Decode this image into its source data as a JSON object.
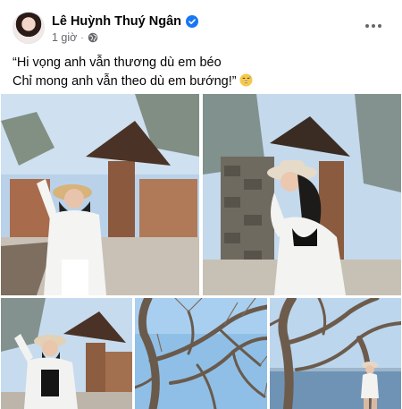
{
  "post": {
    "author": {
      "name": "Lê Huỳnh Thuý Ngân",
      "verified_icon": "verified-badge-icon",
      "avatar_icon": "profile-avatar"
    },
    "timestamp": "1 giờ",
    "separator": "·",
    "privacy_icon": "globe-icon",
    "more_icon": "more-options-icon",
    "caption": {
      "line1": "“Hi vọng anh vẫn thương dù em béo",
      "line2": "Chỉ mong anh vẫn theo dù em bướng!”",
      "emoji_icon": "grinning-sweat-emoji"
    },
    "photos": [
      {
        "icon": "photo-woman-white-shirt-hat-garden"
      },
      {
        "icon": "photo-woman-sun-hat-stone-wall"
      },
      {
        "icon": "photo-woman-hat-gazebo"
      },
      {
        "icon": "photo-bare-tree-sky"
      },
      {
        "icon": "photo-tree-sea-view"
      }
    ]
  },
  "colors": {
    "primary_text": "#050505",
    "secondary_text": "#65676b",
    "verified_blue": "#1877f2",
    "background": "#ffffff"
  }
}
